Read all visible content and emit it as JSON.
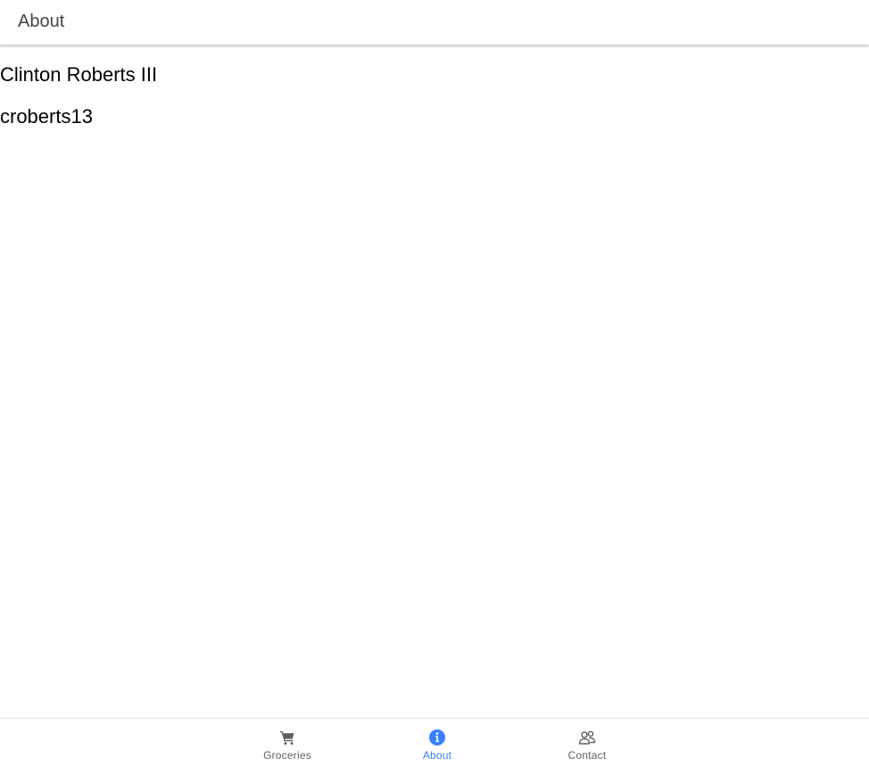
{
  "header": {
    "title": "About"
  },
  "about": {
    "name": "Clinton Roberts III",
    "username": "croberts13"
  },
  "tabs": [
    {
      "label": "Groceries",
      "icon": "cart-icon",
      "selected": false
    },
    {
      "label": "About",
      "icon": "info-circle-icon",
      "selected": true
    },
    {
      "label": "Contact",
      "icon": "people-icon",
      "selected": false
    }
  ],
  "colors": {
    "accent": "#3880ff",
    "tab_inactive": "#5f5f5f",
    "header_text": "#444444"
  }
}
